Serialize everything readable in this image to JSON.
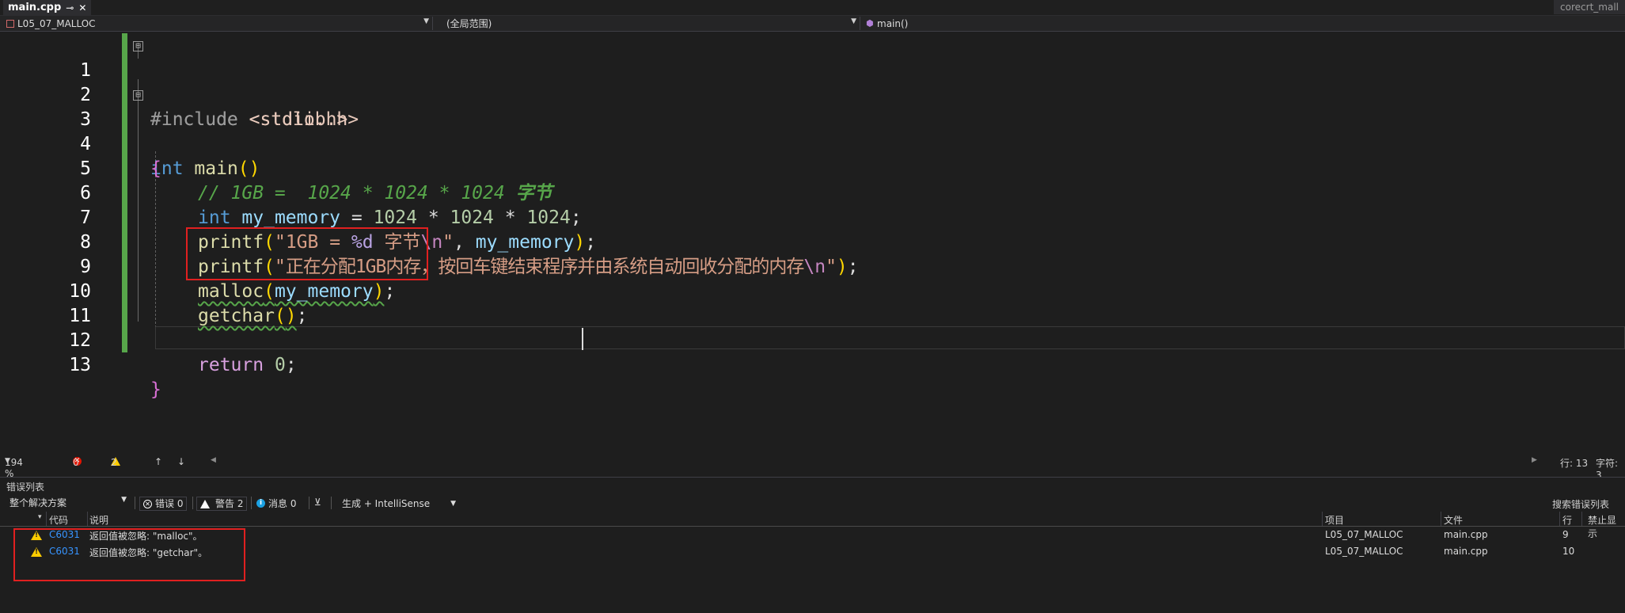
{
  "tab": {
    "title": "main.cpp",
    "pin": "⊸",
    "close": "✕"
  },
  "right_tab": "corecrt_mall",
  "navbar": {
    "project": "L05_07_MALLOC",
    "scope": "(全局范围)",
    "member": "main()"
  },
  "editor": {
    "line_numbers": [
      "1",
      "2",
      "3",
      "4",
      "5",
      "6",
      "7",
      "8",
      "9",
      "10",
      "11",
      "12",
      "13"
    ],
    "lines": {
      "l1": {
        "directive": "#include",
        "header": "<stdio.h>"
      },
      "l2": {
        "directive": "#include",
        "header": "<stdlib.h>"
      },
      "l3": {
        "type": "int",
        "name": "main",
        "parens": "()"
      },
      "l4": {
        "brace": "{"
      },
      "l5": {
        "comment": "// 1GB =  1024 * 1024 * 1024 ",
        "comment_cjk": "字节"
      },
      "l6": {
        "type": "int",
        "var": "my_memory",
        "eq": " = ",
        "n1": "1024",
        "op1": " * ",
        "n2": "1024",
        "op2": " * ",
        "n3": "1024",
        "semi": ";"
      },
      "l7": {
        "fn": "printf",
        "open": "(",
        "q1": "\"",
        "s1": "1GB = ",
        "fmt": "%d",
        "s2": " 字节",
        "esc": "\\n",
        "q2": "\"",
        "comma": ", ",
        "arg": "my_memory",
        "close": ")",
        "semi": ";"
      },
      "l8": {
        "fn": "printf",
        "open": "(",
        "q1": "\"",
        "s1": "正在分配1GB内存，按回车键结束程序并由系统自动回收分配的内存",
        "esc": "\\n",
        "q2": "\"",
        "close": ")",
        "semi": ";"
      },
      "l9": {
        "fn": "malloc",
        "open": "(",
        "arg": "my_memory",
        "close": ")",
        "semi": ";"
      },
      "l10": {
        "fn": "getchar",
        "open": "(",
        "close": ")",
        "semi": ";"
      },
      "l12": {
        "kw": "return",
        "num": "0",
        "semi": ";"
      },
      "l13": {
        "brace": "}"
      }
    },
    "fold_markers": [
      "⊟",
      "⊟"
    ]
  },
  "status": {
    "zoom": "194 %",
    "errors": "0",
    "warnings": "2",
    "up": "↑",
    "down": "↓",
    "line": "行: 13",
    "char": "字符: 3"
  },
  "error_list": {
    "title": "错误列表",
    "scope": "整个解决方案",
    "errors_btn": "错误 0",
    "warnings_btn": "警告 2",
    "messages_btn": "消息 0",
    "build_filter": "生成 + IntelliSense",
    "search": "搜索错误列表",
    "headers": {
      "code": "代码",
      "desc": "说明",
      "project": "项目",
      "file": "文件",
      "line": "行",
      "suppress": "禁止显示"
    },
    "rows": [
      {
        "code": "C6031",
        "desc": "返回值被忽略: \"malloc\"。",
        "project": "L05_07_MALLOC",
        "file": "main.cpp",
        "line": "9"
      },
      {
        "code": "C6031",
        "desc": "返回值被忽略: \"getchar\"。",
        "project": "L05_07_MALLOC",
        "file": "main.cpp",
        "line": "10"
      }
    ]
  },
  "colors": {
    "keyword": "#569cd6",
    "function": "#dcdcaa",
    "string": "#d69d85",
    "comment": "#57a64a",
    "highlight": "#e02020",
    "warning": "#ffcc00"
  }
}
